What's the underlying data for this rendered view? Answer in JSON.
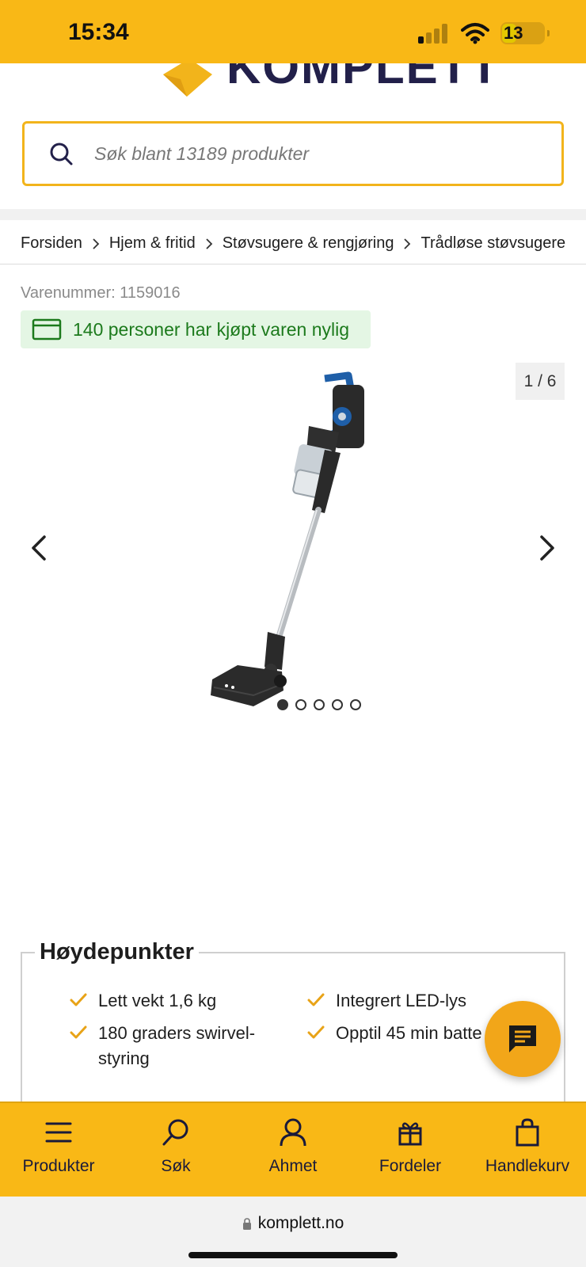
{
  "status_bar": {
    "time": "15:34",
    "battery": "13"
  },
  "header": {
    "logo_text": "KOMPLETT",
    "search_placeholder": "Søk blant 13189 produkter"
  },
  "breadcrumb": [
    "Forsiden",
    "Hjem & fritid",
    "Støvsugere & rengjøring",
    "Trådløse støvsugere"
  ],
  "product": {
    "sku": "Varenummer: 1159016",
    "bought_badge": "140 personer har kjøpt varen nylig",
    "image_counter": "1 / 6",
    "image_dots": 5,
    "active_dot": 0
  },
  "highlights": {
    "title": "Høydepunkter",
    "items": [
      "Lett vekt 1,6 kg",
      "180 graders swirvel-styring",
      "Integrert LED-lys",
      "Opptil 45 min batte"
    ],
    "item_lines": [
      [
        "Lett vekt 1,6 kg"
      ],
      [
        "180 graders swirvel-",
        "styring"
      ],
      [
        "Integrert LED-lys"
      ],
      [
        "Opptil 45 min batte"
      ]
    ]
  },
  "bottom_nav": [
    {
      "label": "Produkter",
      "icon": "menu-icon"
    },
    {
      "label": "Søk",
      "icon": "search-icon"
    },
    {
      "label": "Ahmet",
      "icon": "user-icon"
    },
    {
      "label": "Fordeler",
      "icon": "gift-icon"
    },
    {
      "label": "Handlekurv",
      "icon": "shopping-bag-icon"
    }
  ],
  "url_bar": {
    "url": "komplett.no"
  },
  "colors": {
    "brand_yellow": "#f9b816",
    "brand_navy": "#22204a",
    "success_green": "#1c7a1c",
    "accent_orange": "#f2a619"
  }
}
